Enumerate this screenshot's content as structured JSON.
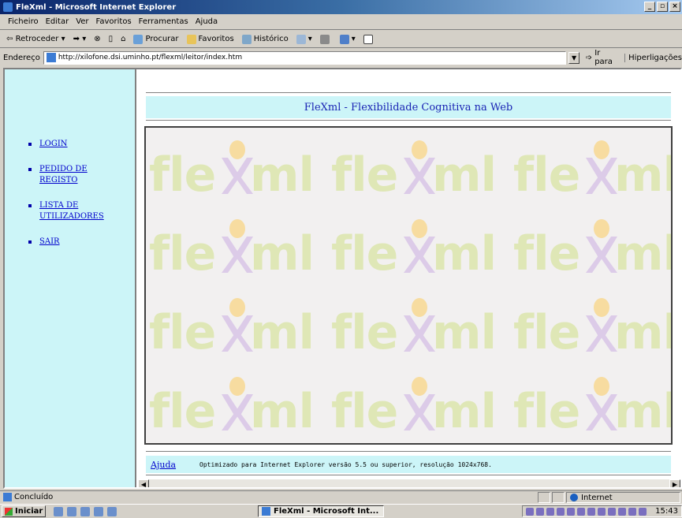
{
  "window": {
    "title": "FleXml - Microsoft Internet Explorer"
  },
  "menu": [
    "Ficheiro",
    "Editar",
    "Ver",
    "Favoritos",
    "Ferramentas",
    "Ajuda"
  ],
  "toolbar": {
    "back": "Retroceder",
    "search": "Procurar",
    "favorites": "Favoritos",
    "history": "Histórico"
  },
  "address": {
    "label": "Endereço",
    "url": "http://xilofone.dsi.uminho.pt/flexml/leitor/index.htm",
    "go": "Ir para",
    "links": "Hiperligações"
  },
  "sidebar": {
    "items": [
      {
        "label": "LOGIN"
      },
      {
        "label": "PEDIDO DE REGISTO"
      },
      {
        "label": "LISTA DE UTILIZADORES"
      },
      {
        "label": "SAIR"
      }
    ]
  },
  "main": {
    "header": "FleXml - Flexibilidade Cognitiva na Web",
    "banner_word_left": "fle",
    "banner_word_right": "ml",
    "footer_link": "Ajuda",
    "footer_note": "Optimizado para Internet Explorer versão 5.5 ou superior, resolução 1024x768."
  },
  "status": {
    "text": "Concluído",
    "zone": "Internet"
  },
  "taskbar": {
    "start": "Iniciar",
    "task": "FleXml - Microsoft Int...",
    "clock": "15:43"
  }
}
